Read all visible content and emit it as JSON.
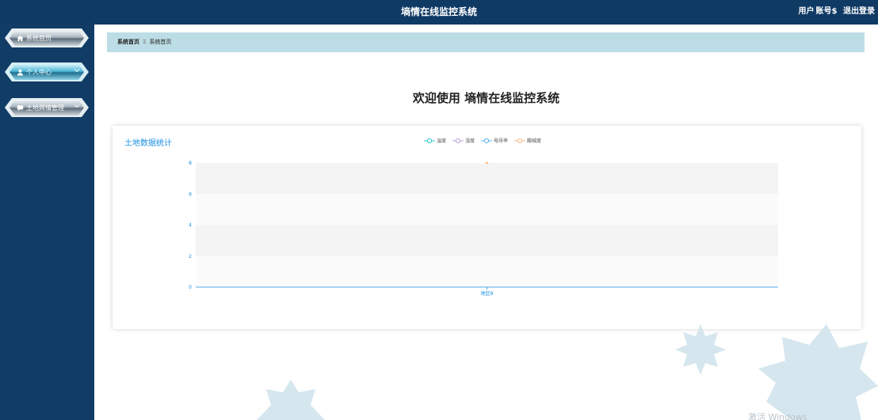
{
  "header": {
    "app_title": "墒情在线监控系统",
    "user_label": "用户",
    "account_label": "账号$",
    "logout_label": "退出登录"
  },
  "sidebar": {
    "items": [
      {
        "label": "系统首页",
        "icon": "home-icon"
      },
      {
        "label": "个人中心",
        "icon": "user-icon",
        "chevron": "chevron-down-icon"
      },
      {
        "label": "土地舆情管理",
        "icon": "message-icon",
        "chevron": "chevron-down-icon"
      }
    ]
  },
  "breadcrumb": {
    "home": "系统首页",
    "separator": "Ξ",
    "current": "系统首页"
  },
  "welcome_text": "欢迎使用 墒情在线监控系统",
  "panel_title": "土地数据统计",
  "colors": {
    "topbar": "#0f3a64",
    "sidebar": "#103c66",
    "breadcrumb_bg": "#bcdde5",
    "accent": "#1a8fe3"
  },
  "chart_data": {
    "type": "line",
    "categories": [
      "地区8"
    ],
    "series": [
      {
        "name": "温度",
        "values": [
          null
        ],
        "color": "#2ec7c9"
      },
      {
        "name": "湿度",
        "values": [
          null
        ],
        "color": "#b6a2de"
      },
      {
        "name": "电导率",
        "values": [
          null
        ],
        "color": "#5ab1ef"
      },
      {
        "name": "酸碱度",
        "values": [
          8
        ],
        "color": "#ffb980"
      }
    ],
    "ylim": [
      0,
      8
    ],
    "yticks": [
      0,
      2,
      4,
      6,
      8
    ],
    "legend": "top-center",
    "grid": true
  },
  "watermark": "激活 Windows"
}
